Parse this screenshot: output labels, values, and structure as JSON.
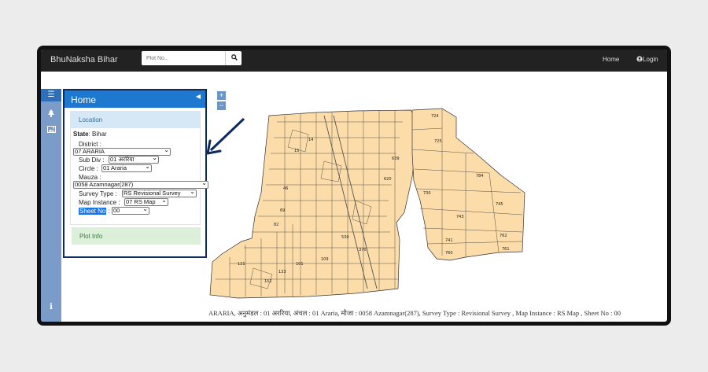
{
  "navbar": {
    "brand": "BhuNaksha Bihar",
    "search_placeholder": "Plot No..",
    "home_label": "Home",
    "login_label": "Login"
  },
  "panel": {
    "title": "Home",
    "location_title": "Location",
    "state_label": "State",
    "state_value": "Bihar",
    "district_label": "District :",
    "district_value": "07 ARARIA",
    "subdiv_label": "Sub Div :",
    "subdiv_value": "01 अररिया",
    "circle_label": "Circle :",
    "circle_value": "01 Araria",
    "mauza_label": "Mauza :",
    "mauza_value": "0058 Azamnagar(287)",
    "survey_label": "Survey Type :",
    "survey_value": "RS Revisional Survey",
    "map_instance_label": "Map Instance :",
    "map_instance_value": "07 RS Map",
    "sheet_label": "Sheet No",
    "sheet_value": "00",
    "plot_info_title": "Plot Info"
  },
  "map": {
    "plot_labels": [
      "724",
      "725",
      "784",
      "745",
      "743",
      "741",
      "762",
      "761",
      "760",
      "730",
      "15",
      "14",
      "620",
      "639",
      "530",
      "370",
      "101",
      "133",
      "121",
      "152",
      "109",
      "82",
      "69",
      "46"
    ],
    "status_text": "ARARIA, अनुमंडल : 01 अररिया, अंचल : 01 Araria, मौजा : 0058 Azamnagar(287), Survey Type : Revisional Survey , Map Instance : RS Map , Sheet No : 00"
  },
  "colors": {
    "navbar": "#222222",
    "panel_header": "#1e78d0",
    "panel_border": "#0e2a5e",
    "sidebar": "#7b9cc8",
    "map_fill": "#fcdca9",
    "arrow": "#0e2a5e"
  },
  "icons": [
    "menu-icon",
    "tree-icon",
    "image-icon",
    "info-icon",
    "search-icon",
    "user-icon",
    "zoom-in-icon",
    "zoom-out-icon"
  ]
}
